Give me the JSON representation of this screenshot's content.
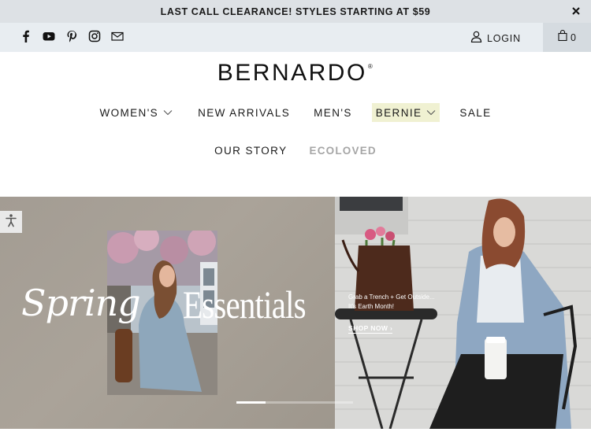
{
  "announcement": {
    "text": "LAST CALL CLEARANCE! STYLES STARTING AT $59",
    "close_icon": "close-icon"
  },
  "utility": {
    "social_icons": [
      "facebook-icon",
      "youtube-icon",
      "pinterest-icon",
      "instagram-icon",
      "email-icon"
    ],
    "login_label": "LOGIN",
    "cart_count": "0"
  },
  "brand": {
    "logo": "BERNARDO",
    "registered": "®"
  },
  "nav": {
    "row1": [
      {
        "label": "WOMEN'S",
        "dropdown": true
      },
      {
        "label": "NEW ARRIVALS",
        "dropdown": false
      },
      {
        "label": "MEN'S",
        "dropdown": false
      },
      {
        "label": "BERNIE",
        "dropdown": true,
        "highlight": true
      },
      {
        "label": "SALE",
        "dropdown": false
      }
    ],
    "row2": [
      {
        "label": "OUR STORY"
      },
      {
        "label": "ECOLOVED"
      }
    ]
  },
  "hero": {
    "headline_left": "Spring",
    "headline_right": "Essentials",
    "promo_line1": "Grab a Trench + Get Outside...",
    "promo_line2": "It's Earth Month!",
    "cta": "SHOP NOW",
    "slide_progress": 0.25
  },
  "colors": {
    "announcement_bg": "#dde1e5",
    "utility_bg": "#e8edf1",
    "highlight_bg": "#f0f1d2",
    "muted_nav": "#a6a6a6"
  }
}
